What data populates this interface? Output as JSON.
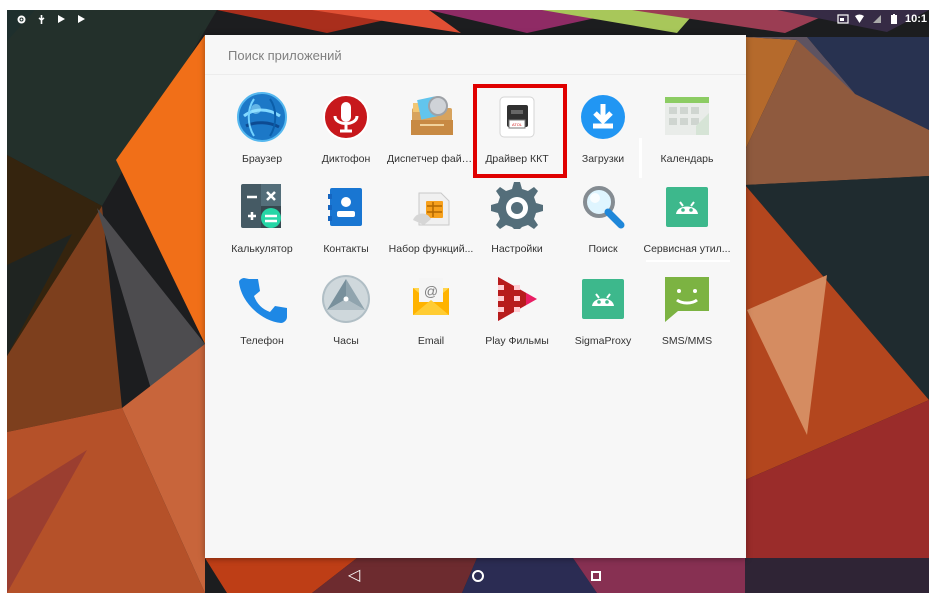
{
  "status_bar": {
    "left_icons": [
      "settings-icon",
      "usb-icon",
      "play-icon",
      "play-icon"
    ],
    "right_icons": [
      "cast-icon",
      "wifi-icon",
      "signal-icon",
      "battery-icon"
    ],
    "time": "10:1"
  },
  "search": {
    "placeholder": "Поиск приложений",
    "value": ""
  },
  "apps": [
    {
      "name": "browser",
      "label": "Браузер",
      "icon": "browser-globe-icon"
    },
    {
      "name": "dictaphone",
      "label": "Диктофон",
      "icon": "microphone-icon"
    },
    {
      "name": "file-manager",
      "label": "Диспетчер файл...",
      "icon": "file-manager-icon"
    },
    {
      "name": "kkt-driver",
      "label": "Драйвер ККТ",
      "icon": "printer-icon"
    },
    {
      "name": "downloads",
      "label": "Загрузки",
      "icon": "download-icon"
    },
    {
      "name": "calendar",
      "label": "Календарь",
      "icon": "calendar-icon"
    },
    {
      "name": "calculator",
      "label": "Калькулятор",
      "icon": "calculator-icon"
    },
    {
      "name": "contacts",
      "label": "Контакты",
      "icon": "contacts-icon"
    },
    {
      "name": "toolkit",
      "label": "Набор функций...",
      "icon": "sim-toolkit-icon"
    },
    {
      "name": "settings",
      "label": "Настройки",
      "icon": "gear-icon"
    },
    {
      "name": "search",
      "label": "Поиск",
      "icon": "magnifier-icon"
    },
    {
      "name": "service-utility",
      "label": "Сервисная утил...",
      "icon": "android-icon"
    },
    {
      "name": "phone",
      "label": "Телефон",
      "icon": "phone-icon"
    },
    {
      "name": "clock",
      "label": "Часы",
      "icon": "clock-icon"
    },
    {
      "name": "email",
      "label": "Email",
      "icon": "email-icon"
    },
    {
      "name": "play-movies",
      "label": "Play Фильмы",
      "icon": "play-movies-icon"
    },
    {
      "name": "sigma-proxy",
      "label": "SigmaProxy",
      "icon": "android-icon"
    },
    {
      "name": "sms-mms",
      "label": "SMS/MMS",
      "icon": "message-icon"
    }
  ],
  "nav": {
    "back": "◁",
    "home": "○",
    "recents": "□"
  },
  "colors": {
    "drawer_background": "#f7f7f7",
    "highlight": "#e00000",
    "text": "#333333",
    "search_placeholder": "#808080",
    "android_green": "#3db88c",
    "blue": "#2196f3"
  }
}
